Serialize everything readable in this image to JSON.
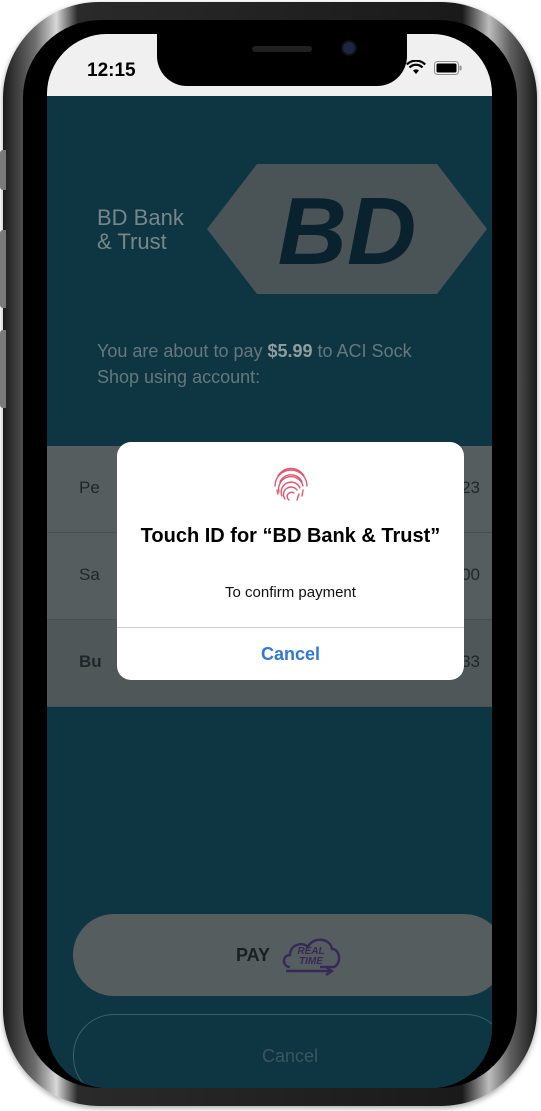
{
  "status": {
    "time": "12:15"
  },
  "bank": {
    "name_line1": "BD Bank",
    "name_line2": "& Trust",
    "logo_text": "BD"
  },
  "payment": {
    "text_before": "You are about to pay ",
    "amount": "$5.99",
    "text_after": " to ACI Sock Shop using account:"
  },
  "accounts": [
    {
      "label": "Pe",
      "amount": "23",
      "selected": false
    },
    {
      "label": "Sa",
      "amount": "00",
      "selected": false
    },
    {
      "label": "Bu",
      "amount": "33",
      "selected": true
    }
  ],
  "buttons": {
    "pay_label": "PAY",
    "pay_badge_line1": "REAL",
    "pay_badge_line2": "TIME",
    "cancel_label": "Cancel"
  },
  "alert": {
    "title": "Touch ID for “BD Bank & Trust”",
    "message": "To confirm payment",
    "cancel_label": "Cancel",
    "icon": "fingerprint-icon"
  },
  "colors": {
    "alert_button": "#2f78d6",
    "fingerprint": "#e2556f",
    "app_background": "#0f3a47"
  }
}
